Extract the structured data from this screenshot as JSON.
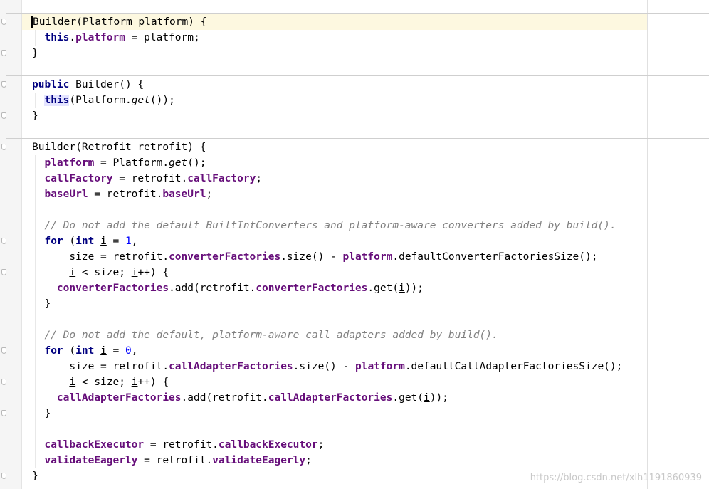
{
  "watermark": "https://blog.csdn.net/xlh1191860939",
  "lines": [
    {
      "t": 20,
      "segs": [
        {
          "c": "caret",
          "v": "B"
        },
        {
          "c": "",
          "v": "uilder(Platform platform) {"
        }
      ]
    },
    {
      "t": 42,
      "segs": [
        {
          "c": "",
          "v": "  "
        },
        {
          "c": "kw",
          "v": "this"
        },
        {
          "c": "",
          "v": "."
        },
        {
          "c": "fld",
          "v": "platform"
        },
        {
          "c": "",
          "v": " = platform;"
        }
      ]
    },
    {
      "t": 64,
      "segs": [
        {
          "c": "",
          "v": "}"
        }
      ]
    },
    {
      "t": 108,
      "segs": [
        {
          "c": "kw",
          "v": "public"
        },
        {
          "c": "",
          "v": " Builder() {"
        }
      ]
    },
    {
      "t": 130,
      "segs": [
        {
          "c": "",
          "v": "  "
        },
        {
          "c": "kw mark-this",
          "v": "this"
        },
        {
          "c": "",
          "v": "(Platform."
        },
        {
          "c": "it",
          "v": "get"
        },
        {
          "c": "",
          "v": "());"
        }
      ]
    },
    {
      "t": 152,
      "segs": [
        {
          "c": "",
          "v": "}"
        }
      ]
    },
    {
      "t": 196,
      "segs": [
        {
          "c": "",
          "v": "Builder(Retrofit retrofit) {"
        }
      ]
    },
    {
      "t": 218,
      "segs": [
        {
          "c": "",
          "v": "  "
        },
        {
          "c": "fld",
          "v": "platform"
        },
        {
          "c": "",
          "v": " = Platform."
        },
        {
          "c": "it",
          "v": "get"
        },
        {
          "c": "",
          "v": "();"
        }
      ]
    },
    {
      "t": 240,
      "segs": [
        {
          "c": "",
          "v": "  "
        },
        {
          "c": "fld",
          "v": "callFactory"
        },
        {
          "c": "",
          "v": " = retrofit."
        },
        {
          "c": "fld",
          "v": "callFactory"
        },
        {
          "c": "",
          "v": ";"
        }
      ]
    },
    {
      "t": 262,
      "segs": [
        {
          "c": "",
          "v": "  "
        },
        {
          "c": "fld",
          "v": "baseUrl"
        },
        {
          "c": "",
          "v": " = retrofit."
        },
        {
          "c": "fld",
          "v": "baseUrl"
        },
        {
          "c": "",
          "v": ";"
        }
      ]
    },
    {
      "t": 306,
      "segs": [
        {
          "c": "",
          "v": "  "
        },
        {
          "c": "cmt",
          "v": "// Do not add the default BuiltIntConverters and platform-aware converters added by build()."
        }
      ]
    },
    {
      "t": 328,
      "segs": [
        {
          "c": "",
          "v": "  "
        },
        {
          "c": "kw",
          "v": "for"
        },
        {
          "c": "",
          "v": " ("
        },
        {
          "c": "kw",
          "v": "int"
        },
        {
          "c": "",
          "v": " "
        },
        {
          "c": "ul",
          "v": "i"
        },
        {
          "c": "",
          "v": " = "
        },
        {
          "c": "num",
          "v": "1"
        },
        {
          "c": "",
          "v": ","
        }
      ]
    },
    {
      "t": 350,
      "segs": [
        {
          "c": "",
          "v": "      size = retrofit."
        },
        {
          "c": "fld",
          "v": "converterFactories"
        },
        {
          "c": "",
          "v": ".size() - "
        },
        {
          "c": "fld",
          "v": "platform"
        },
        {
          "c": "",
          "v": ".defaultConverterFactoriesSize();"
        }
      ]
    },
    {
      "t": 372,
      "segs": [
        {
          "c": "",
          "v": "      "
        },
        {
          "c": "ul",
          "v": "i"
        },
        {
          "c": "",
          "v": " < size; "
        },
        {
          "c": "ul",
          "v": "i"
        },
        {
          "c": "",
          "v": "++) {"
        }
      ]
    },
    {
      "t": 394,
      "segs": [
        {
          "c": "",
          "v": "    "
        },
        {
          "c": "fld",
          "v": "converterFactories"
        },
        {
          "c": "",
          "v": ".add(retrofit."
        },
        {
          "c": "fld",
          "v": "converterFactories"
        },
        {
          "c": "",
          "v": ".get("
        },
        {
          "c": "ul",
          "v": "i"
        },
        {
          "c": "",
          "v": "));"
        }
      ]
    },
    {
      "t": 416,
      "segs": [
        {
          "c": "",
          "v": "  }"
        }
      ]
    },
    {
      "t": 460,
      "segs": [
        {
          "c": "",
          "v": "  "
        },
        {
          "c": "cmt",
          "v": "// Do not add the default, platform-aware call adapters added by build()."
        }
      ]
    },
    {
      "t": 482,
      "segs": [
        {
          "c": "",
          "v": "  "
        },
        {
          "c": "kw",
          "v": "for"
        },
        {
          "c": "",
          "v": " ("
        },
        {
          "c": "kw",
          "v": "int"
        },
        {
          "c": "",
          "v": " "
        },
        {
          "c": "ul",
          "v": "i"
        },
        {
          "c": "",
          "v": " = "
        },
        {
          "c": "num",
          "v": "0"
        },
        {
          "c": "",
          "v": ","
        }
      ]
    },
    {
      "t": 504,
      "segs": [
        {
          "c": "",
          "v": "      size = retrofit."
        },
        {
          "c": "fld",
          "v": "callAdapterFactories"
        },
        {
          "c": "",
          "v": ".size() - "
        },
        {
          "c": "fld",
          "v": "platform"
        },
        {
          "c": "",
          "v": ".defaultCallAdapterFactoriesSize();"
        }
      ]
    },
    {
      "t": 526,
      "segs": [
        {
          "c": "",
          "v": "      "
        },
        {
          "c": "ul",
          "v": "i"
        },
        {
          "c": "",
          "v": " < size; "
        },
        {
          "c": "ul",
          "v": "i"
        },
        {
          "c": "",
          "v": "++) {"
        }
      ]
    },
    {
      "t": 548,
      "segs": [
        {
          "c": "",
          "v": "    "
        },
        {
          "c": "fld",
          "v": "callAdapterFactories"
        },
        {
          "c": "",
          "v": ".add(retrofit."
        },
        {
          "c": "fld",
          "v": "callAdapterFactories"
        },
        {
          "c": "",
          "v": ".get("
        },
        {
          "c": "ul",
          "v": "i"
        },
        {
          "c": "",
          "v": "));"
        }
      ]
    },
    {
      "t": 570,
      "segs": [
        {
          "c": "",
          "v": "  }"
        }
      ]
    },
    {
      "t": 614,
      "segs": [
        {
          "c": "",
          "v": "  "
        },
        {
          "c": "fld",
          "v": "callbackExecutor"
        },
        {
          "c": "",
          "v": " = retrofit."
        },
        {
          "c": "fld",
          "v": "callbackExecutor"
        },
        {
          "c": "",
          "v": ";"
        }
      ]
    },
    {
      "t": 636,
      "segs": [
        {
          "c": "",
          "v": "  "
        },
        {
          "c": "fld",
          "v": "validateEagerly"
        },
        {
          "c": "",
          "v": " = retrofit."
        },
        {
          "c": "fld",
          "v": "validateEagerly"
        },
        {
          "c": "",
          "v": ";"
        }
      ]
    },
    {
      "t": 658,
      "segs": [
        {
          "c": "",
          "v": "}"
        }
      ]
    }
  ]
}
